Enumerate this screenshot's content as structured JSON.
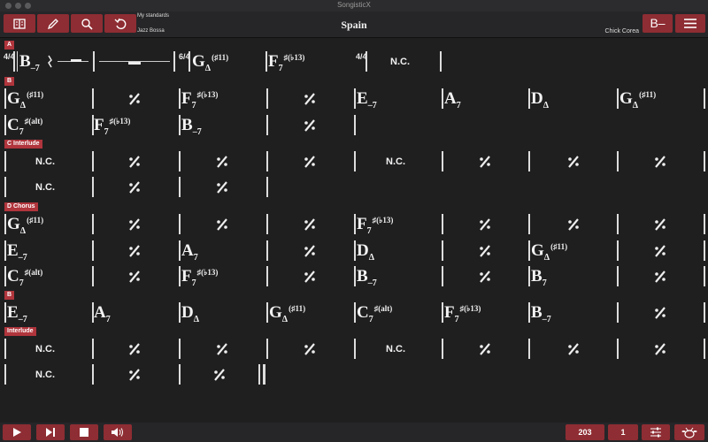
{
  "window": {
    "title": "SongisticX"
  },
  "toolbar": {
    "buttons": [
      {
        "icon": "layout-icon"
      },
      {
        "icon": "pencil-icon"
      },
      {
        "icon": "search-icon"
      },
      {
        "icon": "undo-icon"
      }
    ],
    "collection": "My standards",
    "style": "Jazz Bossa",
    "song_title": "Spain",
    "composer": "Chick Corea",
    "key": "B–",
    "accent": "#8e2d33"
  },
  "sections": {
    "s0": "A",
    "s1": "B",
    "s2": "C Interlude",
    "s3": "D Chorus",
    "s4": "B",
    "s5": "Interlude"
  },
  "chords": {
    "r0": {
      "c1": {
        "root": "B",
        "q": "–7"
      },
      "c2": {
        "root": "G",
        "q": "Δ",
        "ext": "(♯11)"
      },
      "c3": {
        "root": "F",
        "q": "7",
        "ext": "♯(♭13)"
      },
      "c4": "N.C.",
      "ts1": "4/4",
      "ts2": "6/4",
      "ts3": "4/4"
    },
    "r1": [
      {
        "root": "G",
        "q": "Δ",
        "ext": "(♯11)"
      },
      {
        "root": "F",
        "q": "7",
        "ext": "♯(♭13)"
      },
      {
        "root": "E",
        "q": "–7"
      },
      {
        "root": "A",
        "q": "7"
      },
      {
        "root": "D",
        "q": "Δ"
      },
      {
        "root": "G",
        "q": "Δ",
        "ext": "(♯11)"
      }
    ],
    "r2": [
      {
        "root": "C",
        "q": "7",
        "ext": "♯(alt)"
      },
      {
        "root": "F",
        "q": "7",
        "ext": "♯(♭13)"
      },
      {
        "root": "B",
        "q": "–7"
      }
    ],
    "nc": "N.C.",
    "r5": [
      {
        "root": "G",
        "q": "Δ",
        "ext": "(♯11)"
      },
      {
        "root": "F",
        "q": "7",
        "ext": "♯(♭13)"
      }
    ],
    "r6": [
      {
        "root": "E",
        "q": "–7"
      },
      {
        "root": "A",
        "q": "7"
      },
      {
        "root": "D",
        "q": "Δ"
      },
      {
        "root": "G",
        "q": "Δ",
        "ext": "(♯11)"
      }
    ],
    "r7": [
      {
        "root": "C",
        "q": "7",
        "ext": "♯(alt)"
      },
      {
        "root": "F",
        "q": "7",
        "ext": "♯(♭13)"
      },
      {
        "root": "B",
        "q": "–7"
      },
      {
        "root": "B",
        "q": "7"
      }
    ],
    "r8": [
      {
        "root": "E",
        "q": "–7"
      },
      {
        "root": "A",
        "q": "7"
      },
      {
        "root": "D",
        "q": "Δ"
      },
      {
        "root": "G",
        "q": "Δ",
        "ext": "(♯11)"
      },
      {
        "root": "C",
        "q": "7",
        "ext": "♯(alt)"
      },
      {
        "root": "F",
        "q": "7",
        "ext": "♯(♭13)"
      },
      {
        "root": "B",
        "q": "–7"
      }
    ]
  },
  "bottombar": {
    "tempo": "203",
    "transpose": "1"
  }
}
